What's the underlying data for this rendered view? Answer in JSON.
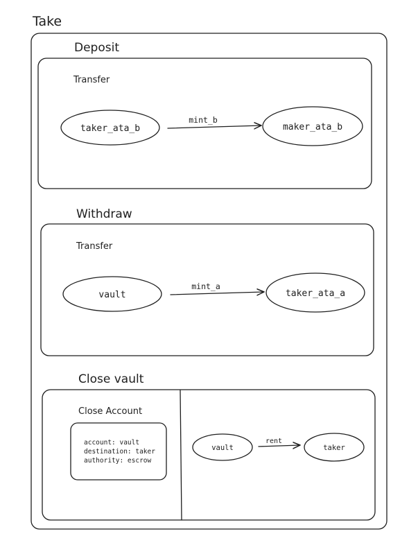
{
  "diagram": {
    "title": "Take",
    "deposit": {
      "heading": "Deposit",
      "action": "Transfer",
      "from": "taker_ata_b",
      "to": "maker_ata_b",
      "edge_label": "mint_b"
    },
    "withdraw": {
      "heading": "Withdraw",
      "action": "Transfer",
      "from": "vault",
      "to": "taker_ata_a",
      "edge_label": "mint_a"
    },
    "close_vault": {
      "heading": "Close vault",
      "action": "Close Account",
      "params": [
        "account: vault",
        "destination: taker",
        "authority: escrow"
      ],
      "from": "vault",
      "to": "taker",
      "edge_label": "rent"
    }
  }
}
